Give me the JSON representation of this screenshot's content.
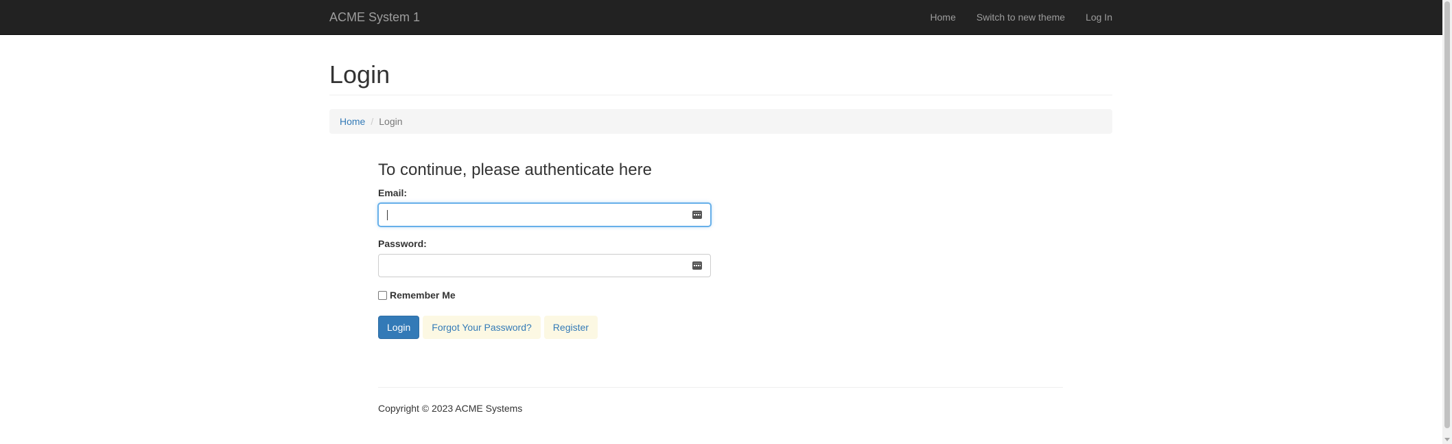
{
  "navbar": {
    "brand": "ACME System 1",
    "links": [
      "Home",
      "Switch to new theme",
      "Log In"
    ]
  },
  "page": {
    "title": "Login"
  },
  "breadcrumb": {
    "home": "Home",
    "separator": "/",
    "current": "Login"
  },
  "form": {
    "heading": "To continue, please authenticate here",
    "email_label": "Email:",
    "email_value": "",
    "password_label": "Password:",
    "password_value": "",
    "remember_label": "Remember Me",
    "remember_checked": false,
    "login_button": "Login",
    "forgot_button": "Forgot Your Password?",
    "register_button": "Register"
  },
  "footer": {
    "copyright": "Copyright © 2023 ACME Systems"
  },
  "colors": {
    "navbar_bg": "#222222",
    "link": "#337ab7",
    "primary_button": "#337ab7",
    "secondary_button_bg": "#fcf8e3"
  }
}
